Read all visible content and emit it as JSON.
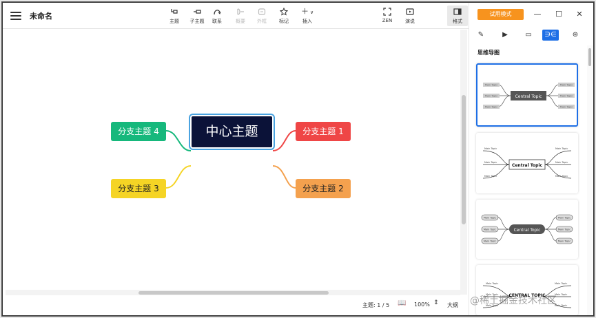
{
  "app": {
    "doc_title": "未命名",
    "trial_label": "试用模式"
  },
  "toolbar": {
    "items": [
      {
        "label": "主题",
        "icon": "topic-icon",
        "enabled": true
      },
      {
        "label": "子主题",
        "icon": "subtopic-icon",
        "enabled": true
      },
      {
        "label": "联系",
        "icon": "relationship-icon",
        "enabled": true
      },
      {
        "label": "概要",
        "icon": "summary-icon",
        "enabled": false
      },
      {
        "label": "外框",
        "icon": "boundary-icon",
        "enabled": false
      },
      {
        "label": "标记",
        "icon": "star-icon",
        "enabled": true
      },
      {
        "label": "插入",
        "icon": "plus-icon",
        "enabled": true
      },
      {
        "label": "ZEN",
        "icon": "zen-icon",
        "enabled": true
      },
      {
        "label": "演说",
        "icon": "present-icon",
        "enabled": true
      },
      {
        "label": "格式",
        "icon": "format-panel-icon",
        "enabled": true
      }
    ]
  },
  "mindmap": {
    "central": "中心主题",
    "branches": [
      {
        "label": "分支主题 1",
        "color": "#ef4646"
      },
      {
        "label": "分支主题 2",
        "color": "#f4a14e"
      },
      {
        "label": "分支主题 3",
        "color": "#f5d425"
      },
      {
        "label": "分支主题 4",
        "color": "#16b87c"
      }
    ]
  },
  "status": {
    "topic_count": "主题: 1 / 5",
    "zoom": "100%",
    "outline_label": "大纲"
  },
  "panel": {
    "section_title": "思维导图",
    "templates": [
      {
        "name": "Central Topic",
        "sub": "Main Topic",
        "style": "dark"
      },
      {
        "name": "Central Topic",
        "sub": "Main Topic",
        "style": "outline"
      },
      {
        "name": "Central Topic",
        "sub": "Main Topic",
        "style": "pill"
      },
      {
        "name": "CENTRAL TOPIC",
        "sub": "Main Topic",
        "style": "caps"
      }
    ]
  },
  "watermark": "@稀土掘金技术社区"
}
